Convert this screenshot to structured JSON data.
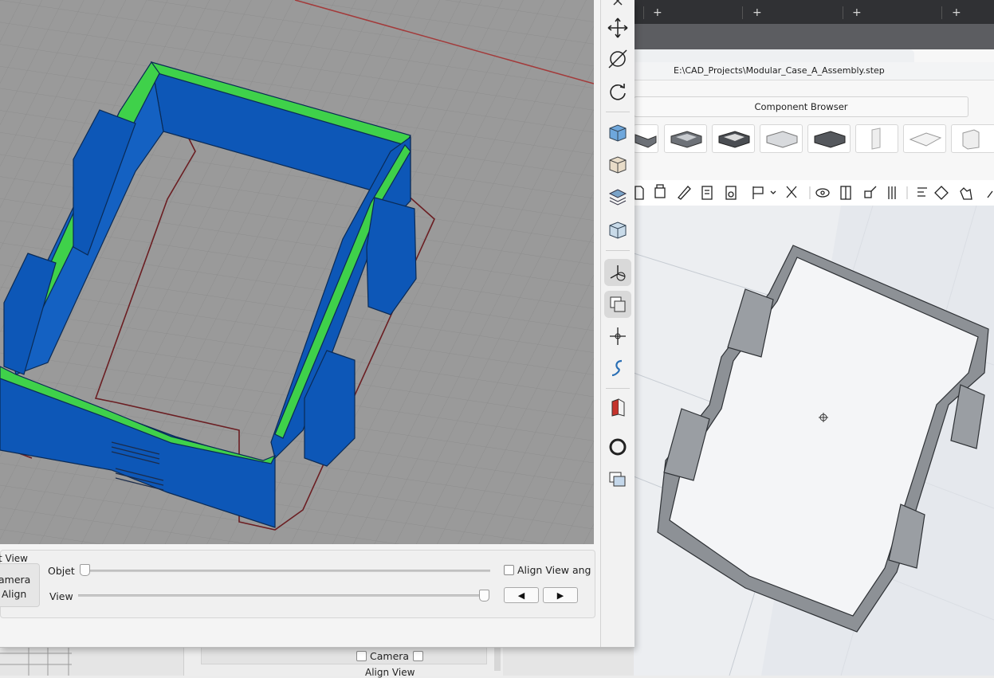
{
  "left_window": {
    "bottom_panel": {
      "group_label": "t View",
      "camera_align_label": "amera",
      "align_label": "Align",
      "objet_label": "Objet",
      "view_label": "View",
      "align_view_label": "Align View ang",
      "objet_value": 0,
      "view_value": 1,
      "prev_symbol": "◀",
      "next_symbol": "▶"
    }
  },
  "cad_window": {
    "file_path": "E:\\CAD_Projects\\Modular_Case_A_Assembly.step",
    "component_browser_label": "Component Browser",
    "tab_plus_symbol": "+"
  },
  "background_dialog": {
    "camera_label": "Camera",
    "align_view_label": "Align View"
  },
  "colors": {
    "model_blue": "#0d57b7",
    "model_green": "#3fd14a",
    "viewport_grey": "#9a9a9a",
    "cad_model_grey": "#8d9196"
  }
}
